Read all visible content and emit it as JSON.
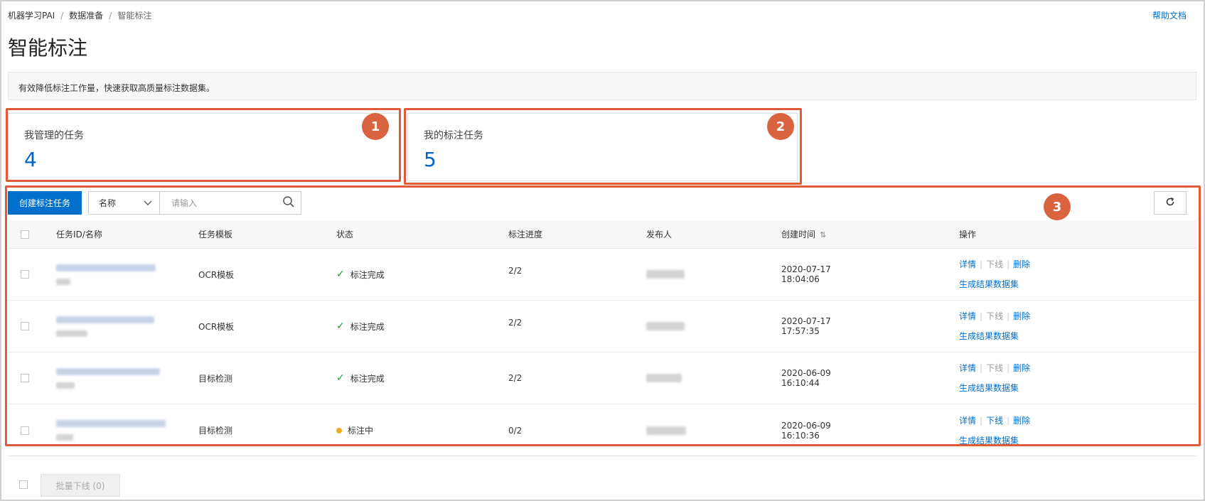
{
  "breadcrumb": [
    "机器学习PAI",
    "数据准备",
    "智能标注"
  ],
  "help_link": "帮助文档",
  "page_title": "智能标注",
  "description": "有效降低标注工作量，快速获取高质量标注数据集。",
  "cards": [
    {
      "label": "我管理的任务",
      "value": "4"
    },
    {
      "label": "我的标注任务",
      "value": "5"
    }
  ],
  "annotations": [
    "1",
    "2",
    "3"
  ],
  "toolbar": {
    "create_label": "创建标注任务",
    "select_value": "名称",
    "search_placeholder": "请输入"
  },
  "table": {
    "headers": [
      "任务ID/名称",
      "任务模板",
      "状态",
      "标注进度",
      "发布人",
      "创建时间",
      "操作"
    ],
    "rows": [
      {
        "template": "OCR模板",
        "status": "标注完成",
        "status_type": "done",
        "progress": "2/2",
        "date": "2020-07-17",
        "time": "18:04:06",
        "offline_enabled": false
      },
      {
        "template": "OCR模板",
        "status": "标注完成",
        "status_type": "done",
        "progress": "2/2",
        "date": "2020-07-17",
        "time": "17:57:35",
        "offline_enabled": false
      },
      {
        "template": "目标检测",
        "status": "标注完成",
        "status_type": "done",
        "progress": "2/2",
        "date": "2020-06-09",
        "time": "16:10:44",
        "offline_enabled": false
      },
      {
        "template": "目标检测",
        "status": "标注中",
        "status_type": "progress",
        "progress": "0/2",
        "date": "2020-06-09",
        "time": "16:10:36",
        "offline_enabled": true
      }
    ],
    "ops": {
      "detail": "详情",
      "offline": "下线",
      "delete": "删除",
      "generate": "生成结果数据集"
    }
  },
  "batch_offline": "批量下线 (0)"
}
